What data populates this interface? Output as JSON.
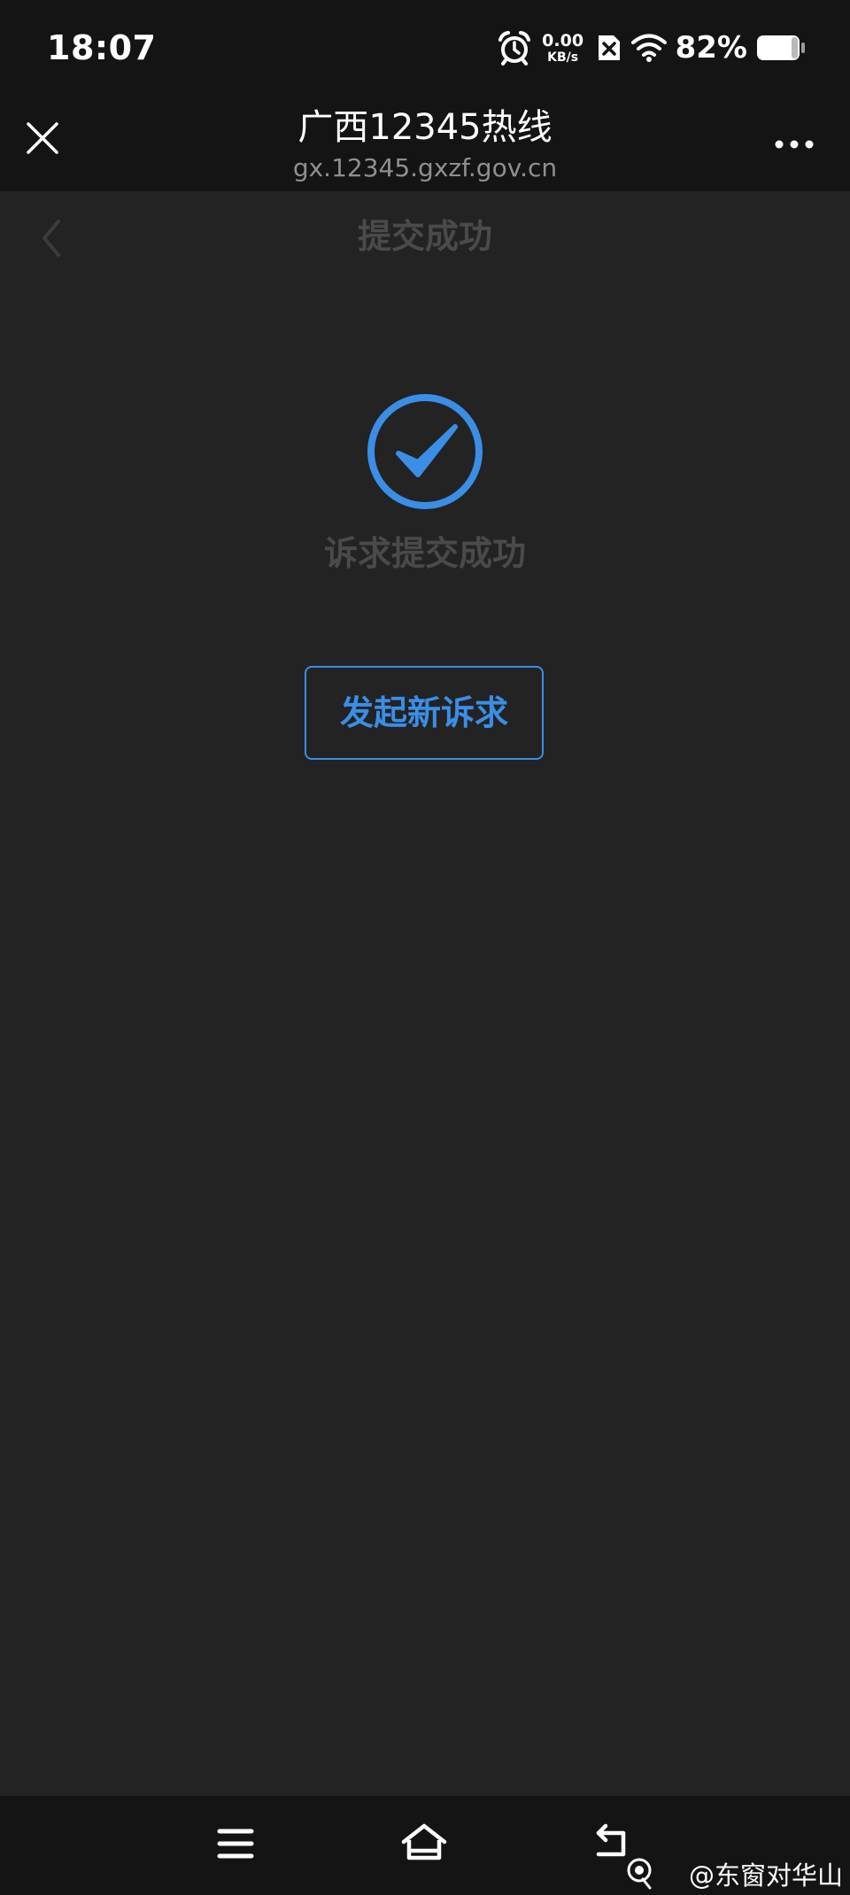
{
  "status_bar": {
    "time": "18:07",
    "net_speed_value": "0.00",
    "net_speed_unit": "KB/s",
    "battery": "82%",
    "icons": [
      "alarm-icon",
      "sim-disabled-icon",
      "wifi-icon",
      "battery-icon"
    ]
  },
  "title_bar": {
    "title": "广西12345热线",
    "url": "gx.12345.gxzf.gov.cn",
    "icons": [
      "close-icon",
      "more-icon"
    ]
  },
  "page_nav": {
    "title": "提交成功",
    "icons": [
      "back-arrow-icon"
    ]
  },
  "content": {
    "success_message": "诉求提交成功",
    "new_request_button": "发起新诉求",
    "icons": [
      "check-circle-icon"
    ]
  },
  "nav_bar": {
    "icons": [
      "menu-icon",
      "home-icon",
      "back-icon"
    ]
  },
  "watermark": {
    "text": "@东窗对华山"
  },
  "colors": {
    "background": "#232323",
    "bars": "#141414",
    "accent": "#3a8ee6",
    "muted_text": "#4a4a4a",
    "url_text": "#8f8f8f"
  }
}
